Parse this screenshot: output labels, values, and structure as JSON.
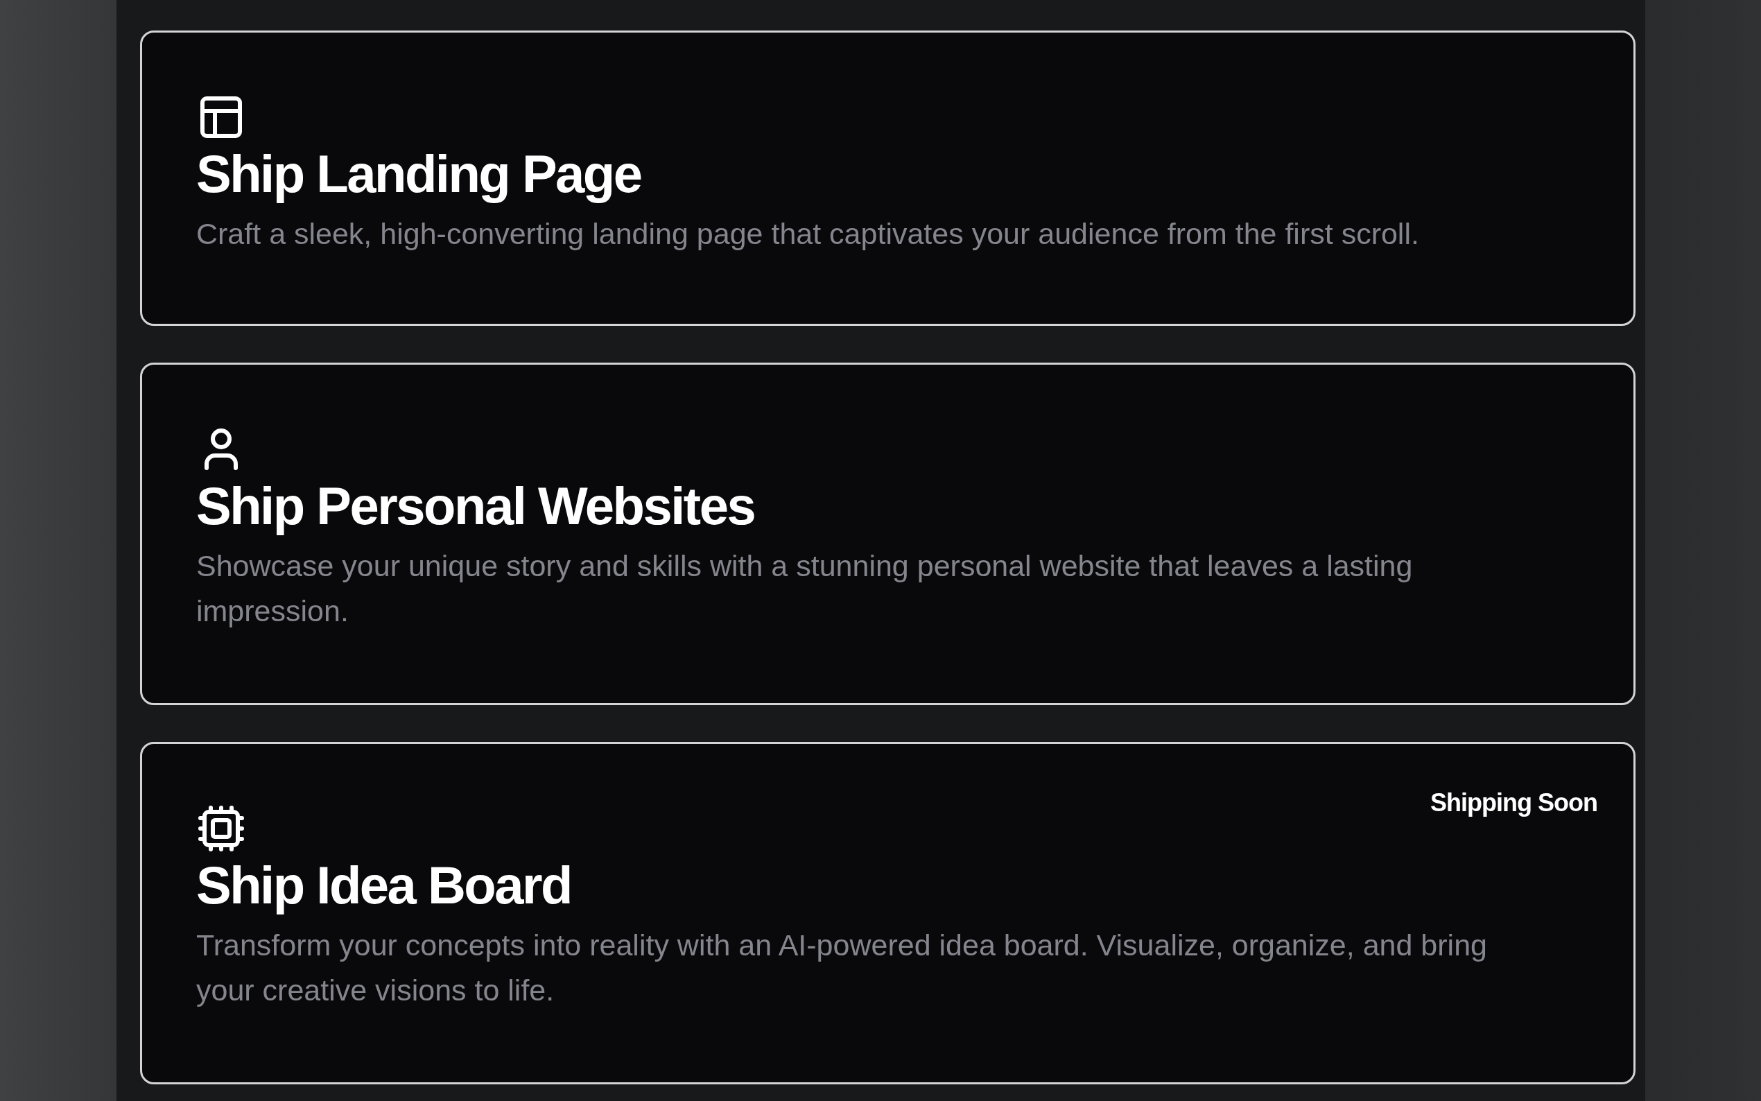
{
  "cards": [
    {
      "title": "Ship Landing Page",
      "description": "Craft a sleek, high-converting landing page that captivates your audience from the first scroll."
    },
    {
      "title": "Ship Personal Websites",
      "description": "Showcase your unique story and skills with a stunning personal website that leaves a lasting impression."
    },
    {
      "title": "Ship Idea Board",
      "description": "Transform your concepts into reality with an AI-powered idea board. Visualize, organize, and bring your creative visions to life.",
      "badge": "Shipping Soon"
    }
  ]
}
